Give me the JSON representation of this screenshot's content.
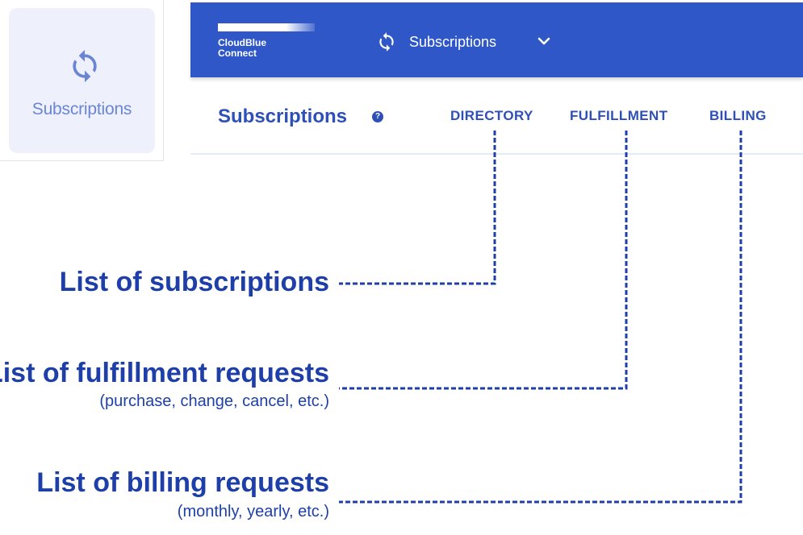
{
  "tile": {
    "icon": "sync-icon",
    "label": "Subscriptions"
  },
  "topbar": {
    "logo_line1": "CloudBlue",
    "logo_line2": "Connect",
    "nav_icon": "sync-icon",
    "nav_label": "Subscriptions",
    "chevron_icon": "chevron-down-icon"
  },
  "subbar": {
    "title": "Subscriptions",
    "help_glyph": "?",
    "tabs": [
      {
        "label": "DIRECTORY"
      },
      {
        "label": "FULFILLMENT"
      },
      {
        "label": "BILLING"
      }
    ]
  },
  "annotations": [
    {
      "title": "List of subscriptions",
      "subtitle": ""
    },
    {
      "title": "List of fulfillment requests",
      "subtitle": "(purchase, change, cancel, etc.)"
    },
    {
      "title": "List of billing requests",
      "subtitle": "(monthly, yearly, etc.)"
    }
  ],
  "colors": {
    "brand_blue": "#2f57c8",
    "annotation_blue": "#1e3fa8",
    "tile_bg": "#eef1fb",
    "tile_text": "#6b85d6"
  }
}
